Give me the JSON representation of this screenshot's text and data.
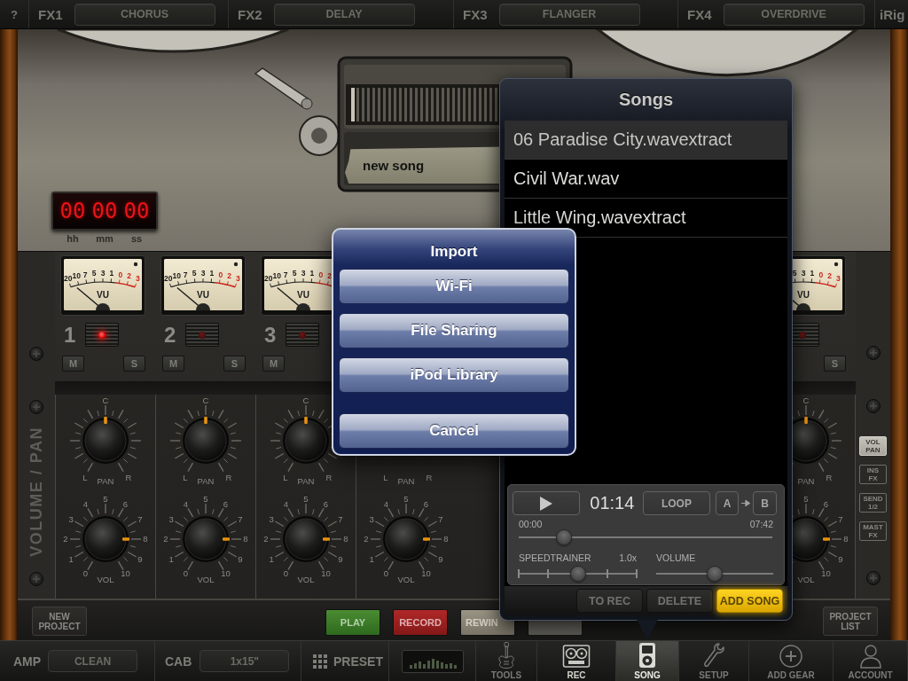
{
  "top_bar": {
    "help": "?",
    "effects": [
      {
        "slot": "FX1",
        "name": "CHORUS"
      },
      {
        "slot": "FX2",
        "name": "DELAY"
      },
      {
        "slot": "FX3",
        "name": "FLANGER"
      },
      {
        "slot": "FX4",
        "name": "OVERDRIVE"
      }
    ],
    "brand": "iRig"
  },
  "recorder": {
    "song_label": "new song",
    "counter": [
      {
        "digits": "00",
        "unit": "hh"
      },
      {
        "digits": "00",
        "unit": "mm"
      },
      {
        "digits": "00",
        "unit": "ss"
      }
    ]
  },
  "mixer": {
    "section_label": "VOLUME / PAN",
    "channels": [
      {
        "number": "1",
        "armed": true,
        "vu": {
          "scale": [
            "20",
            "10",
            "7",
            "5",
            "3",
            "1"
          ],
          "red_scale": [
            "0",
            "2",
            "3"
          ],
          "label": "VU"
        },
        "mute": "M",
        "solo": "S",
        "pan": {
          "center": "C",
          "left": "L",
          "right": "R",
          "name": "PAN",
          "level": 0.5
        },
        "vol": {
          "scale": [
            "0",
            "1",
            "2",
            "3",
            "4",
            "5",
            "6",
            "7",
            "8",
            "9",
            "10"
          ],
          "name": "VOL",
          "level": 0.8
        }
      },
      {
        "number": "2",
        "armed": false,
        "vu": {
          "scale": [
            "20",
            "10",
            "7",
            "5",
            "3",
            "1"
          ],
          "red_scale": [
            "0",
            "2",
            "3"
          ],
          "label": "VU"
        },
        "mute": "M",
        "solo": "S",
        "pan": {
          "center": "C",
          "left": "L",
          "right": "R",
          "name": "PAN",
          "level": 0.5
        },
        "vol": {
          "scale": [
            "0",
            "1",
            "2",
            "3",
            "4",
            "5",
            "6",
            "7",
            "8",
            "9",
            "10"
          ],
          "name": "VOL",
          "level": 0.8
        }
      },
      {
        "number": "3",
        "armed": false,
        "vu": {
          "scale": [
            "20",
            "10",
            "7",
            "5",
            "3",
            "1"
          ],
          "red_scale": [
            "0",
            "2"
          ],
          "label": "VU"
        },
        "mute": "M",
        "pan": {
          "center": "C",
          "left": "L",
          "right": "R",
          "name": "PAN",
          "level": 0.5
        },
        "vol": {
          "scale": [
            "0",
            "1",
            "2",
            "3",
            "4",
            "5",
            "6",
            "7",
            "8",
            "9",
            "10"
          ],
          "name": "VOL",
          "level": 0.8
        }
      },
      {
        "pan": {
          "left": "L",
          "right": "R",
          "name": "PAN"
        },
        "vol": {
          "scale": [
            "0",
            "1",
            "2",
            "3",
            "4",
            "5",
            "6",
            "7",
            "8",
            "9",
            "10"
          ],
          "name": "VOL",
          "level": 0.8
        }
      },
      {
        "armed": false,
        "vu": {
          "scale": [
            "5",
            "3",
            "1"
          ],
          "red_scale": [
            "0",
            "2",
            "3"
          ],
          "label": "VU"
        },
        "solo": "S",
        "pan": {
          "center": "C",
          "right": "R",
          "name": "PAN",
          "level": 0.5
        },
        "vol": {
          "scale": [
            "5",
            "6",
            "7",
            "8",
            "9",
            "10"
          ],
          "name": "VOL",
          "level": 0.8
        }
      }
    ],
    "views": [
      {
        "label": "VOL PAN",
        "selected": true
      },
      {
        "label": "INS FX",
        "selected": false
      },
      {
        "label": "SEND 1/2",
        "selected": false
      },
      {
        "label": "MAST FX",
        "selected": false
      }
    ]
  },
  "transport": {
    "new_project": "NEW PROJECT",
    "buttons": [
      {
        "kind": "play",
        "label": "PLAY"
      },
      {
        "kind": "record",
        "label": "RECORD"
      },
      {
        "kind": "rewind",
        "label": "REWIN"
      },
      {
        "kind": "plain"
      }
    ],
    "project_list": "PROJECT LIST"
  },
  "nav": {
    "amp": {
      "label": "AMP",
      "value": "CLEAN"
    },
    "cab": {
      "label": "CAB",
      "value": "1x15\""
    },
    "preset": "PRESET",
    "tabs": [
      {
        "label": "TOOLS",
        "selected": false,
        "current": false
      },
      {
        "label": "REC",
        "selected": false,
        "current": true
      },
      {
        "label": "SONG",
        "selected": true,
        "current": false
      },
      {
        "label": "SETUP",
        "selected": false,
        "current": false
      },
      {
        "label": "ADD GEAR",
        "selected": false,
        "current": false
      },
      {
        "label": "ACCOUNT",
        "selected": false,
        "current": false
      }
    ]
  },
  "songs": {
    "title": "Songs",
    "items": [
      {
        "name": "06 Paradise City.wavextract",
        "selected": true
      },
      {
        "name": "Civil War.wav",
        "selected": false
      },
      {
        "name": "Little Wing.wavextract",
        "selected": false
      }
    ],
    "player": {
      "time": "01:14",
      "loop": "LOOP",
      "a": "A",
      "b": "B",
      "start": "00:00",
      "end": "07:42",
      "position": {
        "level": 0.18
      },
      "speed": {
        "label": "SPEEDTRAINER",
        "value": "1.0x",
        "level": 0.5
      },
      "volume": {
        "label": "VOLUME",
        "level": 0.5
      }
    },
    "actions": [
      {
        "label": "TO REC",
        "highlighted": false
      },
      {
        "label": "DELETE",
        "highlighted": false
      },
      {
        "label": "ADD SONG",
        "highlighted": true
      }
    ]
  },
  "import_dialog": {
    "title": "Import",
    "options": [
      "Wi-Fi",
      "File Sharing",
      "iPod Library"
    ],
    "cancel": "Cancel"
  }
}
